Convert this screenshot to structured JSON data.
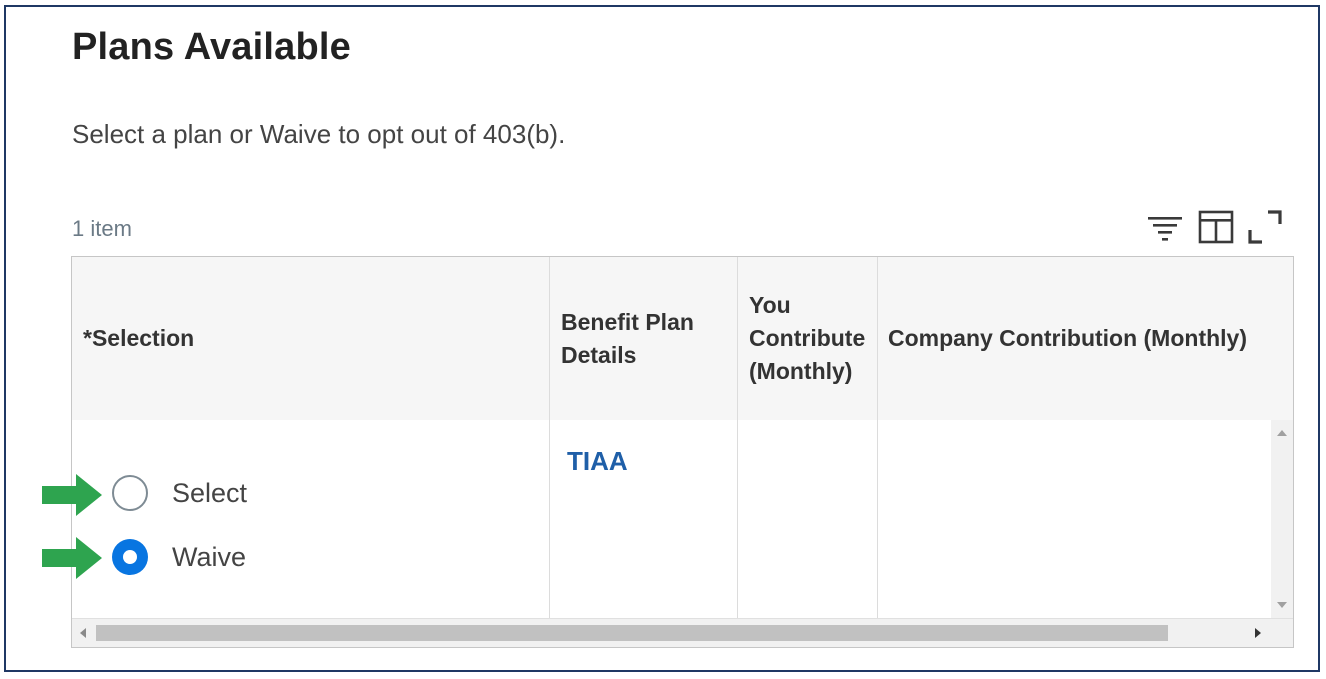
{
  "page": {
    "title": "Plans Available",
    "instructions": "Select a plan or Waive to opt out of 403(b).",
    "item_count": "1 item"
  },
  "toolbar": {
    "icons": [
      "filter-icon",
      "columns-icon",
      "expand-icon"
    ]
  },
  "table": {
    "columns": [
      {
        "label": "*Selection"
      },
      {
        "label": "Benefit Plan Details"
      },
      {
        "label": "You Contribute (Monthly)"
      },
      {
        "label": "Company Contribution (Monthly)"
      }
    ],
    "rows": [
      {
        "options": [
          {
            "label": "Select",
            "checked": false
          },
          {
            "label": "Waive",
            "checked": true
          }
        ],
        "plan": "TIAA",
        "you_contribute": "",
        "company_contribution": ""
      }
    ]
  },
  "colors": {
    "accent": "#0875e1",
    "link": "#1f5fa8",
    "arrow_marker": "#2ea44f",
    "frame_border": "#1f3864"
  }
}
